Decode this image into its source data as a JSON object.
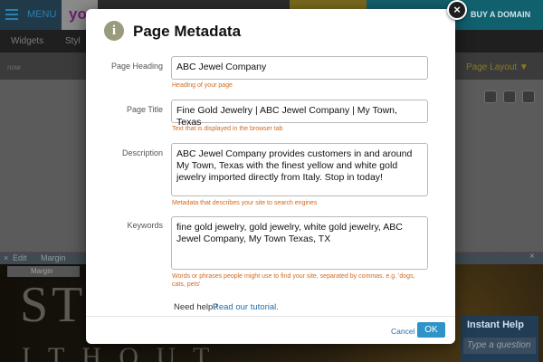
{
  "background": {
    "menu_label": "MENU",
    "logo_text": "yo",
    "buy_domain_label": "BUY A DOMAIN",
    "tabs": {
      "widgets": "Widgets",
      "style": "Styl"
    },
    "now_label": "now",
    "page_layout_label": "Page Layout  ▼",
    "editbar": {
      "close": "×",
      "edit": "Edit",
      "margin": "Margin",
      "x": "×"
    },
    "margin_bar_label": "Margin",
    "hero_text_1": "ST",
    "hero_text_2": "I T H O U T",
    "instant_help": {
      "title": "Instant Help",
      "placeholder": "Type a question"
    }
  },
  "dialog": {
    "title": "Page Metadata",
    "close_icon": "×",
    "info_icon": "i",
    "fields": {
      "heading": {
        "label": "Page Heading",
        "value": "ABC Jewel Company",
        "help": "Heading of your page"
      },
      "title": {
        "label": "Page Title",
        "value": "Fine Gold Jewelry | ABC Jewel Company | My Town, Texas",
        "help": "Text that is displayed in the browser tab"
      },
      "description": {
        "label": "Description",
        "value": "ABC Jewel Company provides customers in and around My Town, Texas with the finest yellow and white gold jewelry imported directly from Italy. Stop in today!",
        "help": "Metadata that describes your site to search engines"
      },
      "keywords": {
        "label": "Keywords",
        "value": "fine gold jewelry, gold jewelry, white gold jewelry, ABC Jewel Company, My Town Texas, TX",
        "help": "Words or phrases people might use to find your site, separated by commas. e.g. 'dogs, cats, pets'"
      }
    },
    "need_help": "Need help?",
    "tutorial_link": "Read our tutorial.",
    "cancel_label": "Cancel",
    "ok_label": "OK"
  },
  "colors": {
    "accent": "#2e93c8",
    "help_text": "#d2691e",
    "link": "#1f6fb0"
  }
}
